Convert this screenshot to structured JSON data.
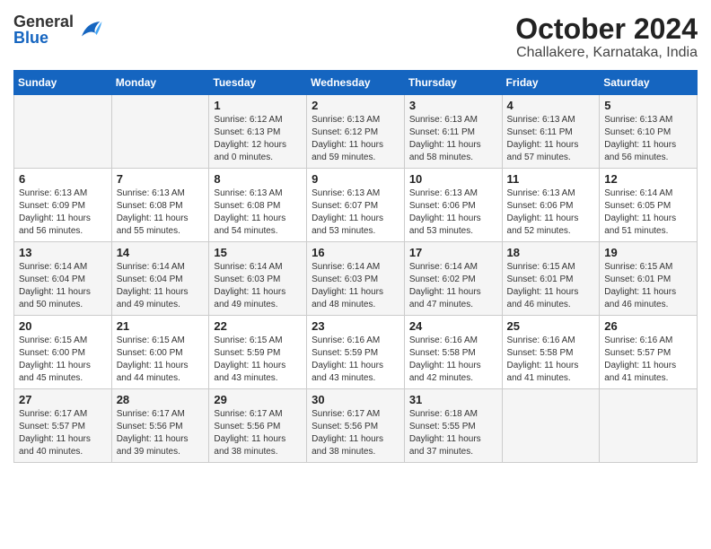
{
  "header": {
    "logo_general": "General",
    "logo_blue": "Blue",
    "month": "October 2024",
    "location": "Challakere, Karnataka, India"
  },
  "days_of_week": [
    "Sunday",
    "Monday",
    "Tuesday",
    "Wednesday",
    "Thursday",
    "Friday",
    "Saturday"
  ],
  "weeks": [
    [
      {
        "day": "",
        "info": ""
      },
      {
        "day": "",
        "info": ""
      },
      {
        "day": "1",
        "info": "Sunrise: 6:12 AM\nSunset: 6:13 PM\nDaylight: 12 hours\nand 0 minutes."
      },
      {
        "day": "2",
        "info": "Sunrise: 6:13 AM\nSunset: 6:12 PM\nDaylight: 11 hours\nand 59 minutes."
      },
      {
        "day": "3",
        "info": "Sunrise: 6:13 AM\nSunset: 6:11 PM\nDaylight: 11 hours\nand 58 minutes."
      },
      {
        "day": "4",
        "info": "Sunrise: 6:13 AM\nSunset: 6:11 PM\nDaylight: 11 hours\nand 57 minutes."
      },
      {
        "day": "5",
        "info": "Sunrise: 6:13 AM\nSunset: 6:10 PM\nDaylight: 11 hours\nand 56 minutes."
      }
    ],
    [
      {
        "day": "6",
        "info": "Sunrise: 6:13 AM\nSunset: 6:09 PM\nDaylight: 11 hours\nand 56 minutes."
      },
      {
        "day": "7",
        "info": "Sunrise: 6:13 AM\nSunset: 6:08 PM\nDaylight: 11 hours\nand 55 minutes."
      },
      {
        "day": "8",
        "info": "Sunrise: 6:13 AM\nSunset: 6:08 PM\nDaylight: 11 hours\nand 54 minutes."
      },
      {
        "day": "9",
        "info": "Sunrise: 6:13 AM\nSunset: 6:07 PM\nDaylight: 11 hours\nand 53 minutes."
      },
      {
        "day": "10",
        "info": "Sunrise: 6:13 AM\nSunset: 6:06 PM\nDaylight: 11 hours\nand 53 minutes."
      },
      {
        "day": "11",
        "info": "Sunrise: 6:13 AM\nSunset: 6:06 PM\nDaylight: 11 hours\nand 52 minutes."
      },
      {
        "day": "12",
        "info": "Sunrise: 6:14 AM\nSunset: 6:05 PM\nDaylight: 11 hours\nand 51 minutes."
      }
    ],
    [
      {
        "day": "13",
        "info": "Sunrise: 6:14 AM\nSunset: 6:04 PM\nDaylight: 11 hours\nand 50 minutes."
      },
      {
        "day": "14",
        "info": "Sunrise: 6:14 AM\nSunset: 6:04 PM\nDaylight: 11 hours\nand 49 minutes."
      },
      {
        "day": "15",
        "info": "Sunrise: 6:14 AM\nSunset: 6:03 PM\nDaylight: 11 hours\nand 49 minutes."
      },
      {
        "day": "16",
        "info": "Sunrise: 6:14 AM\nSunset: 6:03 PM\nDaylight: 11 hours\nand 48 minutes."
      },
      {
        "day": "17",
        "info": "Sunrise: 6:14 AM\nSunset: 6:02 PM\nDaylight: 11 hours\nand 47 minutes."
      },
      {
        "day": "18",
        "info": "Sunrise: 6:15 AM\nSunset: 6:01 PM\nDaylight: 11 hours\nand 46 minutes."
      },
      {
        "day": "19",
        "info": "Sunrise: 6:15 AM\nSunset: 6:01 PM\nDaylight: 11 hours\nand 46 minutes."
      }
    ],
    [
      {
        "day": "20",
        "info": "Sunrise: 6:15 AM\nSunset: 6:00 PM\nDaylight: 11 hours\nand 45 minutes."
      },
      {
        "day": "21",
        "info": "Sunrise: 6:15 AM\nSunset: 6:00 PM\nDaylight: 11 hours\nand 44 minutes."
      },
      {
        "day": "22",
        "info": "Sunrise: 6:15 AM\nSunset: 5:59 PM\nDaylight: 11 hours\nand 43 minutes."
      },
      {
        "day": "23",
        "info": "Sunrise: 6:16 AM\nSunset: 5:59 PM\nDaylight: 11 hours\nand 43 minutes."
      },
      {
        "day": "24",
        "info": "Sunrise: 6:16 AM\nSunset: 5:58 PM\nDaylight: 11 hours\nand 42 minutes."
      },
      {
        "day": "25",
        "info": "Sunrise: 6:16 AM\nSunset: 5:58 PM\nDaylight: 11 hours\nand 41 minutes."
      },
      {
        "day": "26",
        "info": "Sunrise: 6:16 AM\nSunset: 5:57 PM\nDaylight: 11 hours\nand 41 minutes."
      }
    ],
    [
      {
        "day": "27",
        "info": "Sunrise: 6:17 AM\nSunset: 5:57 PM\nDaylight: 11 hours\nand 40 minutes."
      },
      {
        "day": "28",
        "info": "Sunrise: 6:17 AM\nSunset: 5:56 PM\nDaylight: 11 hours\nand 39 minutes."
      },
      {
        "day": "29",
        "info": "Sunrise: 6:17 AM\nSunset: 5:56 PM\nDaylight: 11 hours\nand 38 minutes."
      },
      {
        "day": "30",
        "info": "Sunrise: 6:17 AM\nSunset: 5:56 PM\nDaylight: 11 hours\nand 38 minutes."
      },
      {
        "day": "31",
        "info": "Sunrise: 6:18 AM\nSunset: 5:55 PM\nDaylight: 11 hours\nand 37 minutes."
      },
      {
        "day": "",
        "info": ""
      },
      {
        "day": "",
        "info": ""
      }
    ]
  ]
}
